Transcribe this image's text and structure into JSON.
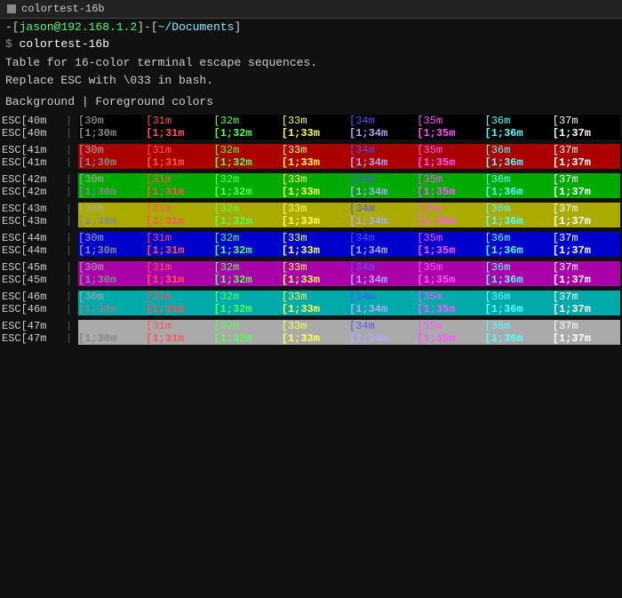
{
  "terminal": {
    "title": "colortest-16b",
    "prompt": {
      "user": "jason",
      "at": "@",
      "host": "192.168.1.2",
      "path": "~/Documents",
      "command": "colortest-16b"
    },
    "info_lines": [
      "Table for 16-color terminal escape sequences.",
      "Replace ESC with \\033 in bash."
    ],
    "header": "Background | Foreground colors",
    "fg_labels": [
      "[31m",
      "[32m",
      "[33m",
      "[34m",
      "[35m",
      "[36m",
      "[37m"
    ],
    "fg_bold_labels": [
      "[1;30m",
      "[1;31m",
      "[1;32m",
      "[1;33m",
      "[1;34m",
      "[1;35m",
      "[1;36m",
      "[1;37m"
    ],
    "rows": [
      {
        "esc": "ESC[40m",
        "bg": "bg-black",
        "fg_colors": [
          "fg-default",
          "fg-red",
          "fg-green",
          "fg-yellow",
          "fg-blue",
          "fg-magenta",
          "fg-cyan",
          "fg-white"
        ],
        "bold_colors": [
          "fg-bold-default",
          "fg-bold-red",
          "fg-bold-green",
          "fg-bold-yellow",
          "fg-bold-blue",
          "fg-bold-magenta",
          "fg-bold-cyan",
          "fg-bold-white"
        ]
      },
      {
        "esc": "ESC[41m",
        "bg": "bg-red",
        "fg_colors": [
          "fg-default",
          "fg-red",
          "fg-green",
          "fg-yellow",
          "fg-blue",
          "fg-magenta",
          "fg-cyan",
          "fg-white"
        ],
        "bold_colors": [
          "fg-bold-default",
          "fg-bold-red",
          "fg-bold-green",
          "fg-bold-yellow",
          "fg-bold-blue",
          "fg-bold-magenta",
          "fg-bold-cyan",
          "fg-bold-white"
        ]
      },
      {
        "esc": "ESC[42m",
        "bg": "bg-green",
        "fg_colors": [
          "fg-default",
          "fg-red",
          "fg-green",
          "fg-yellow",
          "fg-blue",
          "fg-magenta",
          "fg-cyan",
          "fg-white"
        ],
        "bold_colors": [
          "fg-bold-default",
          "fg-bold-red",
          "fg-bold-green",
          "fg-bold-yellow",
          "fg-bold-blue",
          "fg-bold-magenta",
          "fg-bold-cyan",
          "fg-bold-white"
        ]
      },
      {
        "esc": "ESC[43m",
        "bg": "bg-yellow",
        "fg_colors": [
          "fg-default",
          "fg-red",
          "fg-green",
          "fg-yellow",
          "fg-blue",
          "fg-magenta",
          "fg-cyan",
          "fg-white"
        ],
        "bold_colors": [
          "fg-bold-default",
          "fg-bold-red",
          "fg-bold-green",
          "fg-bold-yellow",
          "fg-bold-blue",
          "fg-bold-magenta",
          "fg-bold-cyan",
          "fg-bold-white"
        ]
      },
      {
        "esc": "ESC[44m",
        "bg": "bg-blue",
        "fg_colors": [
          "fg-default",
          "fg-red",
          "fg-green",
          "fg-yellow",
          "fg-blue",
          "fg-magenta",
          "fg-cyan",
          "fg-white"
        ],
        "bold_colors": [
          "fg-bold-default",
          "fg-bold-red",
          "fg-bold-green",
          "fg-bold-yellow",
          "fg-bold-blue",
          "fg-bold-magenta",
          "fg-bold-cyan",
          "fg-bold-white"
        ]
      },
      {
        "esc": "ESC[45m",
        "bg": "bg-magenta",
        "fg_colors": [
          "fg-default",
          "fg-red",
          "fg-green",
          "fg-yellow",
          "fg-blue",
          "fg-magenta",
          "fg-cyan",
          "fg-white"
        ],
        "bold_colors": [
          "fg-bold-default",
          "fg-bold-red",
          "fg-bold-green",
          "fg-bold-yellow",
          "fg-bold-blue",
          "fg-bold-magenta",
          "fg-bold-cyan",
          "fg-bold-white"
        ]
      },
      {
        "esc": "ESC[46m",
        "bg": "bg-cyan",
        "fg_colors": [
          "fg-default",
          "fg-red",
          "fg-green",
          "fg-yellow",
          "fg-blue",
          "fg-magenta",
          "fg-cyan",
          "fg-white"
        ],
        "bold_colors": [
          "fg-bold-default",
          "fg-bold-red",
          "fg-bold-green",
          "fg-bold-yellow",
          "fg-bold-blue",
          "fg-bold-magenta",
          "fg-bold-cyan",
          "fg-bold-white"
        ]
      },
      {
        "esc": "ESC[47m",
        "bg": "bg-white",
        "fg_colors": [
          "fg-default",
          "fg-red",
          "fg-green",
          "fg-yellow",
          "fg-blue",
          "fg-magenta",
          "fg-cyan",
          "fg-white"
        ],
        "bold_colors": [
          "fg-bold-default",
          "fg-bold-red",
          "fg-bold-green",
          "fg-bold-yellow",
          "fg-bold-blue",
          "fg-bold-magenta",
          "fg-bold-cyan",
          "fg-bold-white"
        ]
      }
    ],
    "normal_codes": [
      "[30m",
      "[31m",
      "[32m",
      "[33m",
      "[34m",
      "[35m",
      "[36m",
      "[37m"
    ],
    "bold_codes": [
      "[1;30m",
      "[1;31m",
      "[1;32m",
      "[1;33m",
      "[1;34m",
      "[1;35m",
      "[1;36m",
      "[1;37m"
    ]
  }
}
